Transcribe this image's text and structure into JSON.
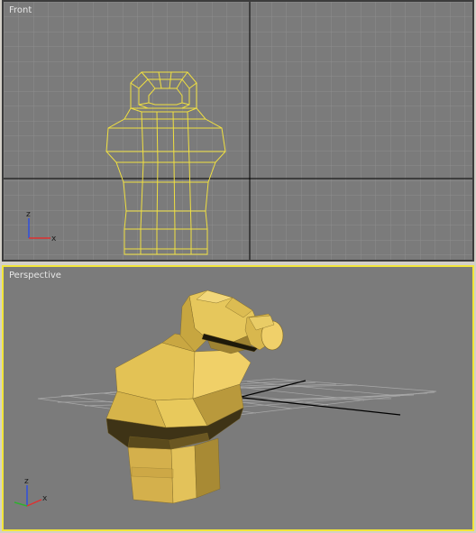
{
  "viewports": {
    "front": {
      "label": "Front"
    },
    "perspective": {
      "label": "Perspective"
    }
  },
  "axis_tripod": {
    "vertical": "z",
    "horizontal": "x"
  },
  "colors": {
    "viewport_bg": "#7b7b7b",
    "grid_line": "#8c8c8c",
    "grid_major": "#000000",
    "wireframe": "#f0e040",
    "active_border": "#f2e63a",
    "mesh_light": "#e8c85a",
    "mesh_mid": "#c9a23c",
    "mesh_dark": "#5a4a1c",
    "axis_x": "#e03030",
    "axis_z": "#3050e0"
  }
}
